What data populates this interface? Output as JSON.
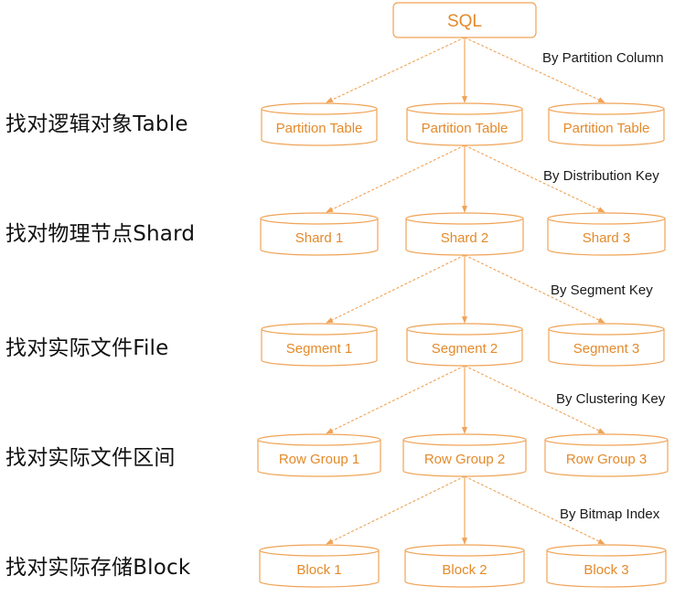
{
  "colors": {
    "accent": "#f0a356",
    "node_text": "#e48a2a",
    "label_text": "#111111"
  },
  "root": {
    "label": "SQL"
  },
  "levels": [
    {
      "label": "找对逻辑对象Table",
      "edge_label": "By Partition Column",
      "nodes": [
        "Partition Table",
        "Partition Table",
        "Partition Table"
      ]
    },
    {
      "label": "找对物理节点Shard",
      "edge_label": "By Distribution Key",
      "nodes": [
        "Shard 1",
        "Shard 2",
        "Shard 3"
      ]
    },
    {
      "label": "找对实际文件File",
      "edge_label": "By Segment Key",
      "nodes": [
        "Segment 1",
        "Segment 2",
        "Segment 3"
      ]
    },
    {
      "label": "找对实际文件区间",
      "edge_label": "By Clustering Key",
      "nodes": [
        "Row Group 1",
        "Row Group 2",
        "Row Group 3"
      ]
    },
    {
      "label": "找对实际存储Block",
      "edge_label": "By Bitmap Index",
      "nodes": [
        "Block 1",
        "Block 2",
        "Block 3"
      ]
    }
  ]
}
